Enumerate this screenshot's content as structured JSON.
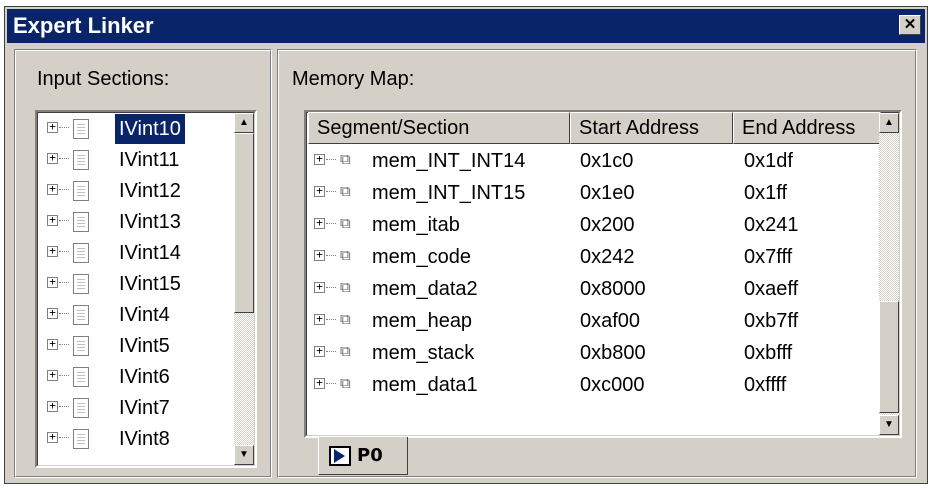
{
  "window": {
    "title": "Expert Linker",
    "close_glyph": "✕"
  },
  "input_sections": {
    "label": "Input Sections:",
    "items": [
      {
        "label": "IVint10",
        "selected": true
      },
      {
        "label": "IVint11"
      },
      {
        "label": "IVint12"
      },
      {
        "label": "IVint13"
      },
      {
        "label": "IVint14"
      },
      {
        "label": "IVint15"
      },
      {
        "label": "IVint4"
      },
      {
        "label": "IVint5"
      },
      {
        "label": "IVint6"
      },
      {
        "label": "IVint7"
      },
      {
        "label": "IVint8"
      }
    ],
    "item_icon": "document-icon"
  },
  "memory_map": {
    "label": "Memory Map:",
    "columns": [
      "Segment/Section",
      "Start Address",
      "End Address"
    ],
    "rows": [
      {
        "segment": "mem_INT_INT14",
        "start": "0x1c0",
        "end": "0x1df"
      },
      {
        "segment": "mem_INT_INT15",
        "start": "0x1e0",
        "end": "0x1ff"
      },
      {
        "segment": "mem_itab",
        "start": "0x200",
        "end": "0x241"
      },
      {
        "segment": "mem_code",
        "start": "0x242",
        "end": "0x7fff"
      },
      {
        "segment": "mem_data2",
        "start": "0x8000",
        "end": "0xaeff"
      },
      {
        "segment": "mem_heap",
        "start": "0xaf00",
        "end": "0xb7ff"
      },
      {
        "segment": "mem_stack",
        "start": "0xb800",
        "end": "0xbfff"
      },
      {
        "segment": "mem_data1",
        "start": "0xc000",
        "end": "0xffff"
      }
    ],
    "row_icon": "memory-chip-icon"
  },
  "tabs": [
    {
      "label": "P0",
      "icon": "processor-play-icon"
    }
  ],
  "scroll": {
    "up_glyph": "▲",
    "down_glyph": "▼"
  },
  "colors": {
    "titlebar": "#0a246a",
    "selection": "#0a246a",
    "face": "#d4d0c8"
  }
}
